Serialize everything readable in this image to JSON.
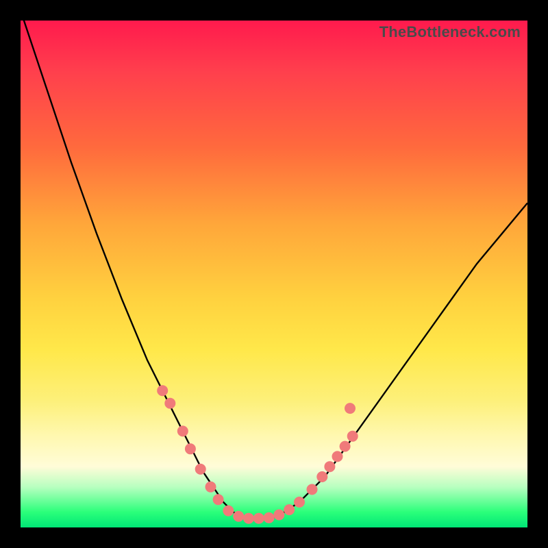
{
  "watermark": "TheBottleneck.com",
  "colors": {
    "curve": "#000000",
    "dot_fill": "#f07a7a",
    "dot_stroke": "#d05a5a"
  },
  "chart_data": {
    "type": "line",
    "title": "",
    "xlabel": "",
    "ylabel": "",
    "xlim": [
      0,
      100
    ],
    "ylim": [
      0,
      100
    ],
    "series": [
      {
        "name": "curve",
        "x": [
          0,
          5,
          10,
          15,
          20,
          25,
          28,
          30,
          32,
          34,
          36,
          38,
          40,
          42,
          44,
          46,
          48,
          50,
          52,
          55,
          60,
          65,
          70,
          75,
          80,
          85,
          90,
          95,
          100
        ],
        "y": [
          102,
          87,
          72,
          58,
          45,
          33,
          27,
          23,
          19,
          15,
          11,
          8,
          5,
          3,
          2,
          2,
          2,
          2,
          3,
          5,
          10,
          17,
          24,
          31,
          38,
          45,
          52,
          58,
          64
        ]
      }
    ],
    "dots": [
      {
        "x": 28.0,
        "y": 27.0
      },
      {
        "x": 29.5,
        "y": 24.5
      },
      {
        "x": 32.0,
        "y": 19.0
      },
      {
        "x": 33.5,
        "y": 15.5
      },
      {
        "x": 35.5,
        "y": 11.5
      },
      {
        "x": 37.5,
        "y": 8.0
      },
      {
        "x": 39.0,
        "y": 5.5
      },
      {
        "x": 41.0,
        "y": 3.3
      },
      {
        "x": 43.0,
        "y": 2.2
      },
      {
        "x": 45.0,
        "y": 1.8
      },
      {
        "x": 47.0,
        "y": 1.8
      },
      {
        "x": 49.0,
        "y": 1.9
      },
      {
        "x": 51.0,
        "y": 2.5
      },
      {
        "x": 53.0,
        "y": 3.5
      },
      {
        "x": 55.0,
        "y": 5.0
      },
      {
        "x": 57.5,
        "y": 7.5
      },
      {
        "x": 59.5,
        "y": 10.0
      },
      {
        "x": 61.0,
        "y": 12.0
      },
      {
        "x": 62.5,
        "y": 14.0
      },
      {
        "x": 64.0,
        "y": 16.0
      },
      {
        "x": 65.5,
        "y": 18.0
      },
      {
        "x": 65.0,
        "y": 23.5
      }
    ],
    "annotations": []
  }
}
